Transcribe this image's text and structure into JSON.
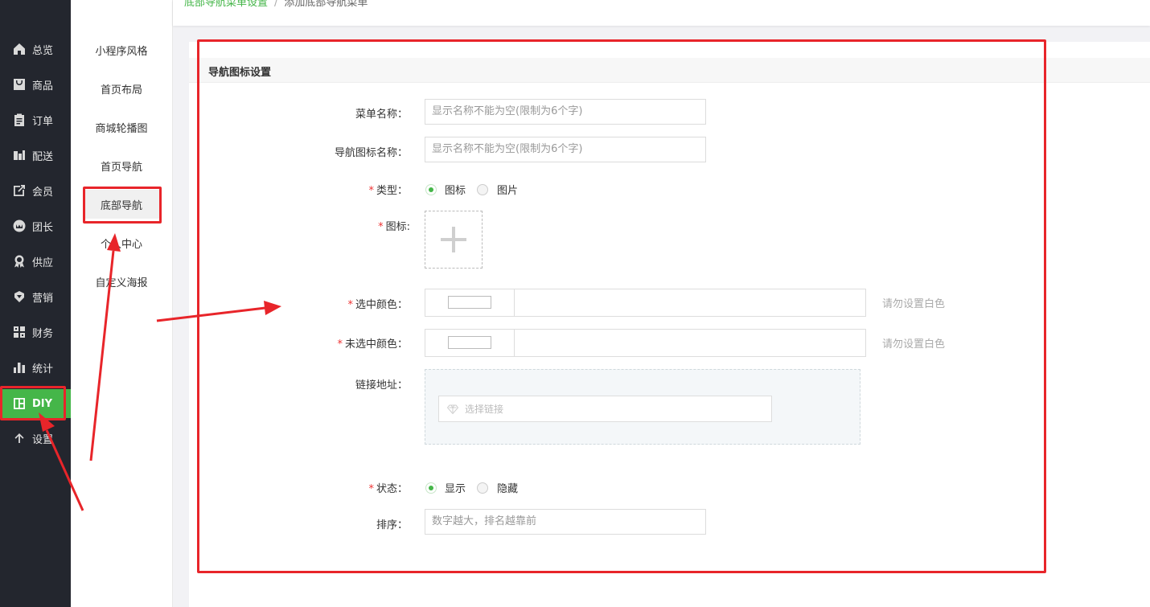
{
  "breadcrumb": {
    "parent": "底部导航菜单设置",
    "separator": "/",
    "current": "添加底部导航菜单"
  },
  "sidebar": {
    "items": [
      {
        "label": "总览",
        "icon": "home-icon"
      },
      {
        "label": "商品",
        "icon": "bag-icon"
      },
      {
        "label": "订单",
        "icon": "clipboard-icon"
      },
      {
        "label": "配送",
        "icon": "delivery-icon"
      },
      {
        "label": "会员",
        "icon": "external-edit-icon"
      },
      {
        "label": "团长",
        "icon": "badge-icon"
      },
      {
        "label": "供应",
        "icon": "award-icon"
      },
      {
        "label": "营销",
        "icon": "marketing-icon"
      },
      {
        "label": "财务",
        "icon": "grid-icon"
      },
      {
        "label": "统计",
        "icon": "bar-chart-icon"
      },
      {
        "label": "DIY",
        "icon": "layout-icon",
        "active": true
      },
      {
        "label": "设置",
        "icon": "arrow-up-icon"
      }
    ],
    "active_color": "#45b649"
  },
  "subnav": {
    "items": [
      {
        "label": "小程序风格"
      },
      {
        "label": "首页布局"
      },
      {
        "label": "商城轮播图"
      },
      {
        "label": "首页导航"
      },
      {
        "label": "底部导航",
        "active": true
      },
      {
        "label": "个人中心"
      },
      {
        "label": "自定义海报"
      }
    ]
  },
  "form": {
    "title": "导航图标设置",
    "menu_name": {
      "label": "菜单名称：",
      "placeholder": "显示名称不能为空(限制为6个字)"
    },
    "icon_name": {
      "label": "导航图标名称：",
      "placeholder": "显示名称不能为空(限制为6个字)"
    },
    "type": {
      "label": "类型：",
      "options": [
        "图标",
        "图片"
      ],
      "selected": "图标"
    },
    "icon": {
      "label": "图标:"
    },
    "selected_color": {
      "label": "选中颜色：",
      "hint": "请勿设置白色"
    },
    "unselected_color": {
      "label": "未选中颜色：",
      "hint": "请勿设置白色"
    },
    "link": {
      "label": "链接地址：",
      "placeholder": "选择链接"
    },
    "status": {
      "label": "状态：",
      "options": [
        "显示",
        "隐藏"
      ],
      "selected": "显示"
    },
    "sort": {
      "label": "排序：",
      "placeholder": "数字越大，排名越靠前"
    },
    "required_mark": "*"
  },
  "annotation_color": "#e8252a"
}
